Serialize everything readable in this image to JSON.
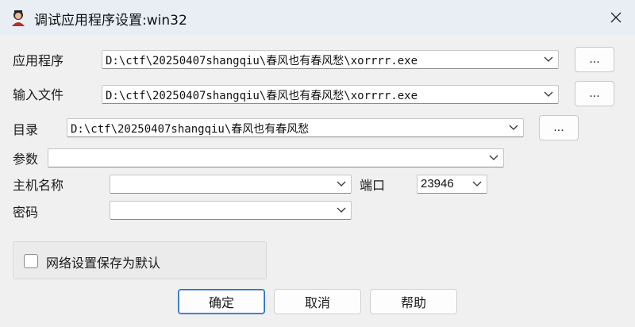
{
  "window": {
    "title": "调试应用程序设置:win32",
    "icon": "app-icon"
  },
  "fields": {
    "application": {
      "label": "应用程序",
      "value": "D:\\ctf\\20250407shangqiu\\春风也有春风愁\\xorrrr.exe",
      "browse_label": "..."
    },
    "input_file": {
      "label": "输入文件",
      "value": "D:\\ctf\\20250407shangqiu\\春风也有春风愁\\xorrrr.exe",
      "browse_label": "..."
    },
    "directory": {
      "label": "目录",
      "value": "D:\\ctf\\20250407shangqiu\\春风也有春风愁",
      "browse_label": "..."
    },
    "parameters": {
      "label": "参数",
      "value": ""
    },
    "hostname": {
      "label": "主机名称",
      "value": ""
    },
    "port": {
      "label": "端口",
      "value": "23946"
    },
    "password": {
      "label": "密码",
      "value": ""
    }
  },
  "options": {
    "save_default_label": "网络设置保存为默认",
    "save_default_checked": false
  },
  "buttons": {
    "ok": "确定",
    "cancel": "取消",
    "help": "帮助"
  },
  "colors": {
    "titlebar": "#e9eef5",
    "background": "#f0f0f0",
    "primary_border": "#2a6fc9"
  }
}
